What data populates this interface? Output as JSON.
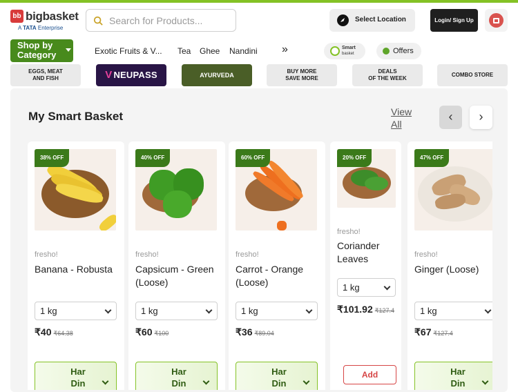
{
  "header": {
    "logo_mark": "bb",
    "logo_text": "bigbasket",
    "logo_sub_prefix": "A",
    "logo_sub_brand": "TATA",
    "logo_sub_suffix": "Enterprise",
    "search_placeholder": "Search for Products...",
    "location_label": "Select Location",
    "login_label": "Login/ Sign Up"
  },
  "nav": {
    "shop_by_category": "Shop by Category",
    "links": [
      "Exotic Fruits & V...",
      "Tea",
      "Ghee",
      "Nandini"
    ],
    "more": "»",
    "smart_basket_line1": "Smart",
    "smart_basket_line2": "basket",
    "offers": "Offers"
  },
  "categories": [
    {
      "label_line1": "EGGS, MEAT",
      "label_line2": "AND FISH"
    },
    {
      "label_line1": "NEUPASS",
      "label_line2": ""
    },
    {
      "label_line1": "AYURVEDA",
      "label_line2": ""
    },
    {
      "label_line1": "BUY MORE",
      "label_line2": "SAVE MORE"
    },
    {
      "label_line1": "DEALS",
      "label_line2": "OF THE WEEK"
    },
    {
      "label_line1": "COMBO STORE",
      "label_line2": ""
    }
  ],
  "neupass_glyph": "V",
  "section": {
    "title": "My Smart Basket",
    "view_all": "View All",
    "prev": "‹",
    "next": "›"
  },
  "products": [
    {
      "badge": "38% OFF",
      "brand": "fresho!",
      "name": "Banana - Robusta",
      "qty": "1 kg",
      "price": "₹40",
      "mrp": "₹64.38",
      "action": "Har Din",
      "produce": "banana"
    },
    {
      "badge": "40% OFF",
      "brand": "fresho!",
      "name": "Capsicum - Green (Loose)",
      "qty": "1 kg",
      "price": "₹60",
      "mrp": "₹100",
      "action": "Har Din",
      "produce": "capsicum"
    },
    {
      "badge": "60% OFF",
      "brand": "fresho!",
      "name": "Carrot - Orange (Loose)",
      "qty": "1 kg",
      "price": "₹36",
      "mrp": "₹89.04",
      "action": "Har Din",
      "produce": "carrot"
    },
    {
      "badge": "20% OFF",
      "brand": "fresho!",
      "name": "Coriander Leaves",
      "qty": "1 kg",
      "price": "₹101.92",
      "mrp": "₹127.4",
      "action": "Add",
      "produce": "coriander"
    },
    {
      "badge": "47% OFF",
      "brand": "fresho!",
      "name": "Ginger (Loose)",
      "qty": "1 kg",
      "price": "₹67",
      "mrp": "₹127.4",
      "action": "Har Din",
      "produce": "ginger"
    }
  ],
  "colors": {
    "brand_green": "#84c225",
    "dark_green": "#488a1c",
    "badge_green": "#3b7a1a",
    "add_red": "#d64545",
    "neupass_bg": "#291546",
    "ayurveda_bg": "#4a5e27"
  },
  "icons": {
    "search": "search-icon",
    "location": "location-compass-icon",
    "cart": "cart-bag-icon",
    "smart_basket": "smart-basket-icon",
    "offers": "offers-badge-icon"
  }
}
